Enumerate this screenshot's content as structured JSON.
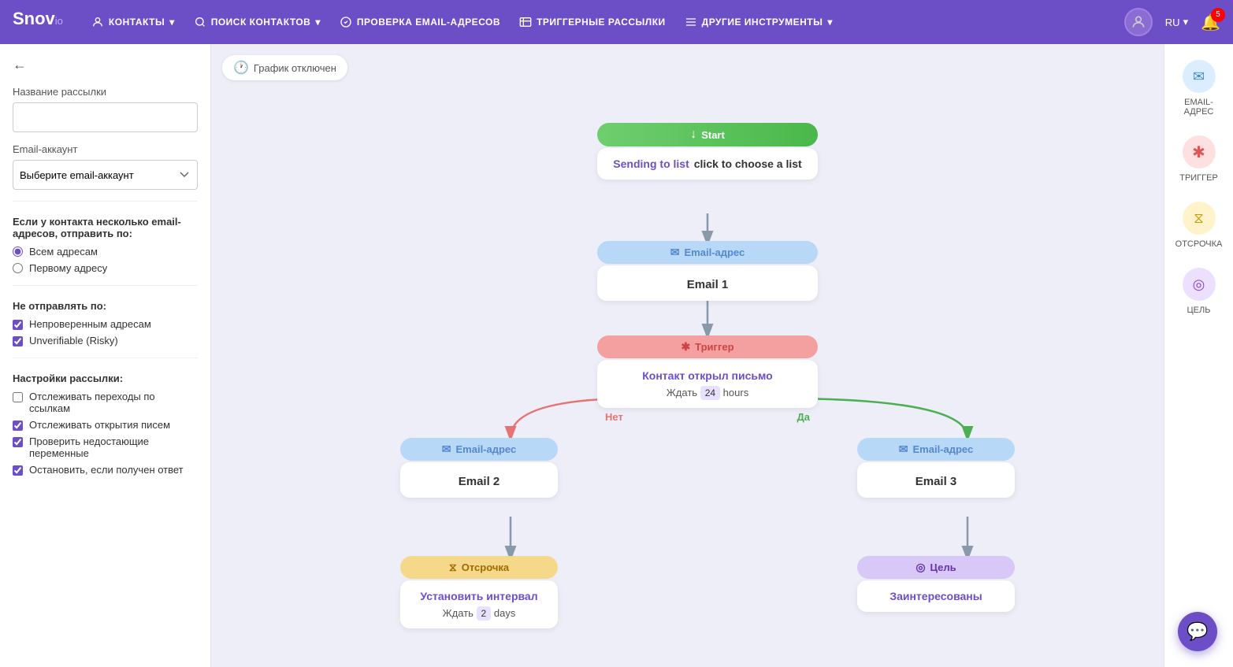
{
  "nav": {
    "logo": "Snov",
    "logo_suffix": "io",
    "items": [
      {
        "id": "contacts",
        "label": "КОНТАКТЫ",
        "has_dropdown": true
      },
      {
        "id": "search",
        "label": "ПОИСК КОНТАКТОВ",
        "has_dropdown": true
      },
      {
        "id": "verify",
        "label": "ПРОВЕРКА EMAIL-АДРЕСОВ",
        "has_dropdown": false
      },
      {
        "id": "trigger",
        "label": "ТРИГГЕРНЫЕ РАССЫЛКИ",
        "has_dropdown": false
      },
      {
        "id": "tools",
        "label": "ДРУГИЕ ИНСТРУМЕНТЫ",
        "has_dropdown": true
      }
    ],
    "lang": "RU",
    "badge_count": "5"
  },
  "sidebar": {
    "back_label": "←",
    "campaign_name_label": "Название рассылки",
    "campaign_name_placeholder": "",
    "email_account_label": "Email-аккаунт",
    "email_account_placeholder": "Выберите email-аккаунт",
    "multi_email_label": "Если у контакта несколько email-адресов, отправить по:",
    "radio_all": "Всем адресам",
    "radio_first": "Первому адресу",
    "do_not_send_label": "Не отправлять по:",
    "checkbox_unverified": "Непроверенным адресам",
    "checkbox_unverifiable": "Unverifiable (Risky)",
    "settings_label": "Настройки рассылки:",
    "checkbox_track_links": "Отслеживать переходы по ссылкам",
    "checkbox_track_opens": "Отслеживать открытия писем",
    "checkbox_check_vars": "Проверить недостающие переменные",
    "checkbox_stop_reply": "Остановить, если получен ответ"
  },
  "canvas": {
    "schedule_badge": "График отключен"
  },
  "flow": {
    "start": {
      "header": "Start",
      "sending_label": "Sending to list",
      "choose_label": "click to choose a list"
    },
    "email1": {
      "header": "Email-адрес",
      "body": "Email 1"
    },
    "trigger": {
      "header": "Триггер",
      "condition": "Контакт открыл письмо",
      "wait_prefix": "Ждать",
      "wait_value": "24",
      "wait_unit": "hours"
    },
    "email2": {
      "header": "Email-адрес",
      "body": "Email 2"
    },
    "email3": {
      "header": "Email-адрес",
      "body": "Email 3"
    },
    "delay": {
      "header": "Отсрочка",
      "action": "Установить интервал",
      "wait_prefix": "Ждать",
      "wait_value": "2",
      "wait_unit": "days"
    },
    "goal": {
      "header": "Цель",
      "body": "Заинтересованы"
    },
    "yes_label": "Да",
    "no_label": "Нет"
  },
  "tools": [
    {
      "id": "email-tool",
      "label": "EMAIL-АДРЕС",
      "icon": "✉"
    },
    {
      "id": "trigger-tool",
      "label": "ТРИГГЕР",
      "icon": "✱"
    },
    {
      "id": "delay-tool",
      "label": "ОТСРОЧКА",
      "icon": "⧖"
    },
    {
      "id": "goal-tool",
      "label": "ЦЕЛЬ",
      "icon": "◎"
    }
  ]
}
